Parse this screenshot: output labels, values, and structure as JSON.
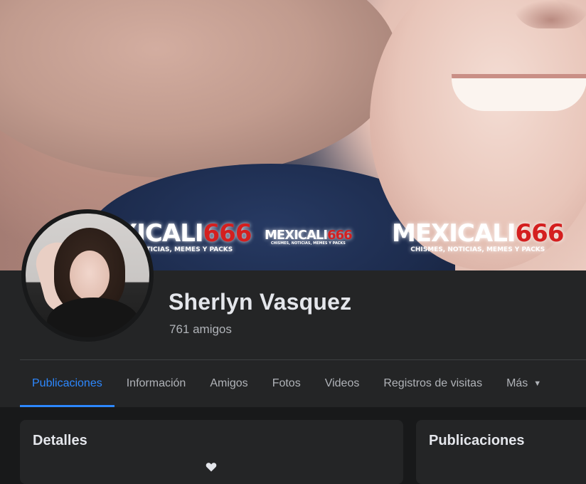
{
  "cover": {
    "watermarks": [
      {
        "brand": "MEXICALI",
        "number": "666",
        "tagline": "CHISMES, NOTICIAS, MEMES Y PACKS"
      },
      {
        "brand": "MEXICALI",
        "number": "666",
        "tagline": "CHISMES, NOTICIAS, MEMES Y PACKS"
      },
      {
        "brand": "MEXICALI",
        "number": "666",
        "tagline": "CHISMES, NOTICIAS, MEMES Y PACKS"
      }
    ]
  },
  "profile": {
    "name": "Sherlyn Vasquez",
    "friends": "761 amigos"
  },
  "tabs": [
    {
      "label": "Publicaciones",
      "active": true
    },
    {
      "label": "Información"
    },
    {
      "label": "Amigos"
    },
    {
      "label": "Fotos"
    },
    {
      "label": "Videos"
    },
    {
      "label": "Registros de visitas"
    },
    {
      "label": "Más",
      "icon": "caret-down-icon"
    }
  ],
  "details_card": {
    "title": "Detalles",
    "icon": "heart-icon"
  },
  "posts_card": {
    "title": "Publicaciones"
  },
  "colors": {
    "background": "#18191a",
    "surface": "#242526",
    "accent": "#2d88ff",
    "text_primary": "#e4e6eb",
    "text_secondary": "#b0b3b8"
  }
}
